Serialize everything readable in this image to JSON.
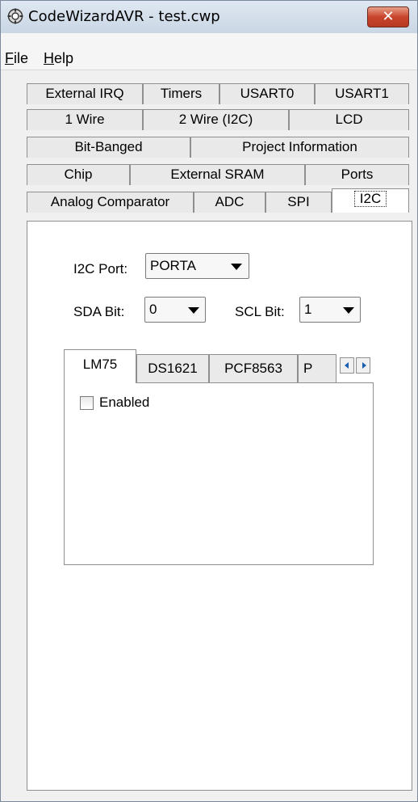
{
  "window": {
    "title": "CodeWizardAVR - test.cwp"
  },
  "menu": {
    "file_rest": "ile",
    "file_accel": "F",
    "help_rest": "elp",
    "help_accel": "H"
  },
  "tabs": {
    "row1": [
      "External IRQ",
      "Timers",
      "USART0",
      "USART1"
    ],
    "row2": [
      "1 Wire",
      "2 Wire (I2C)",
      "LCD"
    ],
    "row3": [
      "Bit-Banged",
      "Project Information"
    ],
    "row4": [
      "Chip",
      "External SRAM",
      "Ports"
    ],
    "row5": [
      "Analog Comparator",
      "ADC",
      "SPI",
      "I2C"
    ],
    "active": "I2C"
  },
  "i2c": {
    "port_label": "I2C Port:",
    "port_value": "PORTA",
    "sda_label": "SDA Bit:",
    "sda_value": "0",
    "scl_label": "SCL Bit:",
    "scl_value": "1"
  },
  "devices": {
    "tabs": [
      "LM75",
      "DS1621",
      "PCF8563",
      "P"
    ],
    "active": "LM75",
    "enabled_label": "Enabled",
    "enabled": false
  }
}
